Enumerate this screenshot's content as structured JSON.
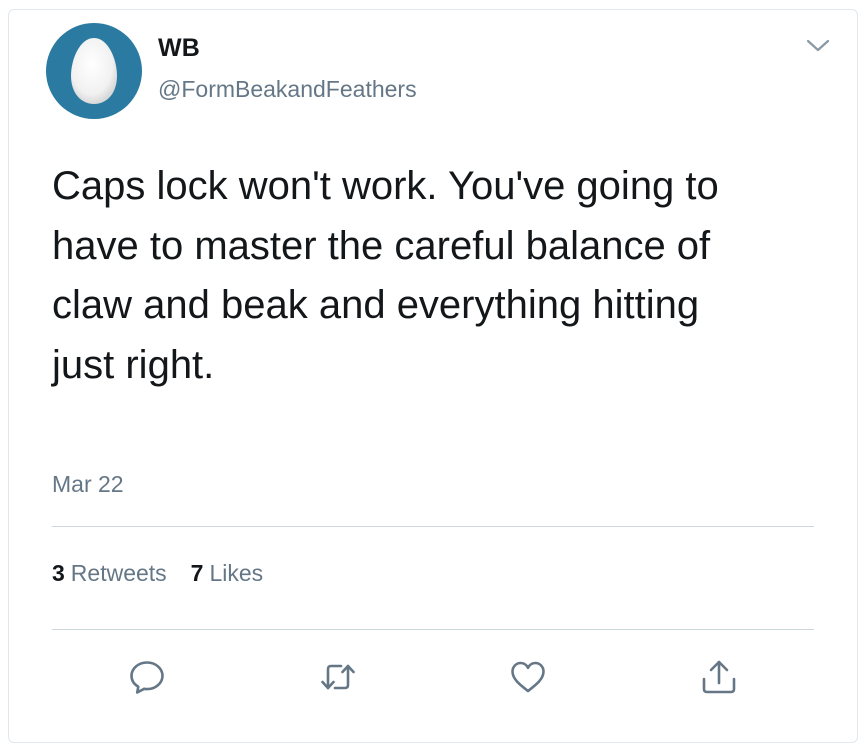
{
  "author": {
    "display_name": "WB",
    "handle": "@FormBeakandFeathers",
    "avatar_color": "#2a7aa1"
  },
  "tweet": {
    "text": "Caps lock won't work. You've going to\nhave to master the careful balance of\nclaw and beak and everything hitting\njust right.",
    "date": "Mar 22"
  },
  "stats": {
    "retweets_count": "3",
    "retweets_label": "Retweets",
    "likes_count": "7",
    "likes_label": "Likes"
  },
  "icons": {
    "menu": "chevron-down-icon",
    "reply": "reply-icon",
    "retweet": "retweet-icon",
    "like": "heart-icon",
    "share": "share-icon"
  },
  "colors": {
    "text_primary": "#14171a",
    "text_secondary": "#657786",
    "divider": "#ccd6dd",
    "icon": "#657786"
  }
}
